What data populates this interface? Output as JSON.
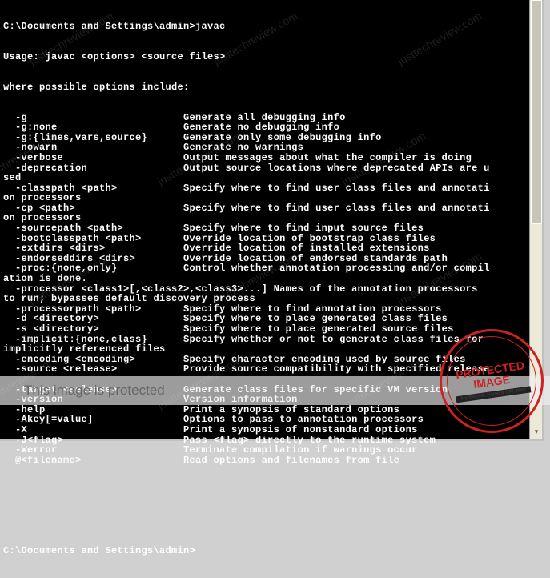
{
  "prompt1": "C:\\Documents and Settings\\admin>javac",
  "usage": "Usage: javac <options> <source files>",
  "optionsHeader": "where possible options include:",
  "options": [
    {
      "flag": "  -g",
      "desc": "Generate all debugging info"
    },
    {
      "flag": "  -g:none",
      "desc": "Generate no debugging info"
    },
    {
      "flag": "  -g:{lines,vars,source}",
      "desc": "Generate only some debugging info"
    },
    {
      "flag": "  -nowarn",
      "desc": "Generate no warnings"
    },
    {
      "flag": "  -verbose",
      "desc": "Output messages about what the compiler is doing"
    },
    {
      "flag": "  -deprecation",
      "desc": "Output source locations where deprecated APIs are u",
      "cont": "sed"
    },
    {
      "flag": "  -classpath <path>",
      "desc": "Specify where to find user class files and annotati",
      "cont": "on processors"
    },
    {
      "flag": "  -cp <path>",
      "desc": "Specify where to find user class files and annotati",
      "cont": "on processors"
    },
    {
      "flag": "  -sourcepath <path>",
      "desc": "Specify where to find input source files"
    },
    {
      "flag": "  -bootclasspath <path>",
      "desc": "Override location of bootstrap class files"
    },
    {
      "flag": "  -extdirs <dirs>",
      "desc": "Override location of installed extensions"
    },
    {
      "flag": "  -endorseddirs <dirs>",
      "desc": "Override location of endorsed standards path"
    },
    {
      "flag": "  -proc:{none,only}",
      "desc": "Control whether annotation processing and/or compil",
      "cont": "ation is done."
    },
    {
      "flag": "  -processor <class1>[,<class2>,<class3>...] Names of the annotation processors ",
      "desc": "",
      "full": true,
      "cont": "to run; bypasses default discovery process"
    },
    {
      "flag": "  -processorpath <path>",
      "desc": "Specify where to find annotation processors"
    },
    {
      "flag": "  -d <directory>",
      "desc": "Specify where to place generated class files"
    },
    {
      "flag": "  -s <directory>",
      "desc": "Specify where to place generated source files"
    },
    {
      "flag": "  -implicit:{none,class}",
      "desc": "Specify whether or not to generate class files for ",
      "cont": "implicitly referenced files"
    },
    {
      "flag": "  -encoding <encoding>",
      "desc": "Specify character encoding used by source files"
    },
    {
      "flag": "  -source <release>",
      "desc": "Provide source compatibility with specified release"
    },
    {
      "flag": "",
      "desc": ""
    },
    {
      "flag": "  -target <release>",
      "desc": "Generate class files for specific VM version"
    },
    {
      "flag": "  -version",
      "desc": "Version information"
    },
    {
      "flag": "  -help",
      "desc": "Print a synopsis of standard options"
    },
    {
      "flag": "  -Akey[=value]",
      "desc": "Options to pass to annotation processors"
    },
    {
      "flag": "  -X",
      "desc": "Print a synopsis of nonstandard options"
    },
    {
      "flag": "  -J<flag>",
      "desc": "Pass <flag> directly to the runtime system"
    },
    {
      "flag": "  -Werror",
      "desc": "Terminate compilation if warnings occur"
    },
    {
      "flag": "  @<filename>",
      "desc": "Read options and filenames from file"
    }
  ],
  "prompt2": "C:\\Documents and Settings\\admin>",
  "watermark_text": "justtechreview.com",
  "protected_text": "This image is protected",
  "stamp_text": "PROTECTED IMAGE",
  "stamp_sub": "My Website Name & URL here"
}
